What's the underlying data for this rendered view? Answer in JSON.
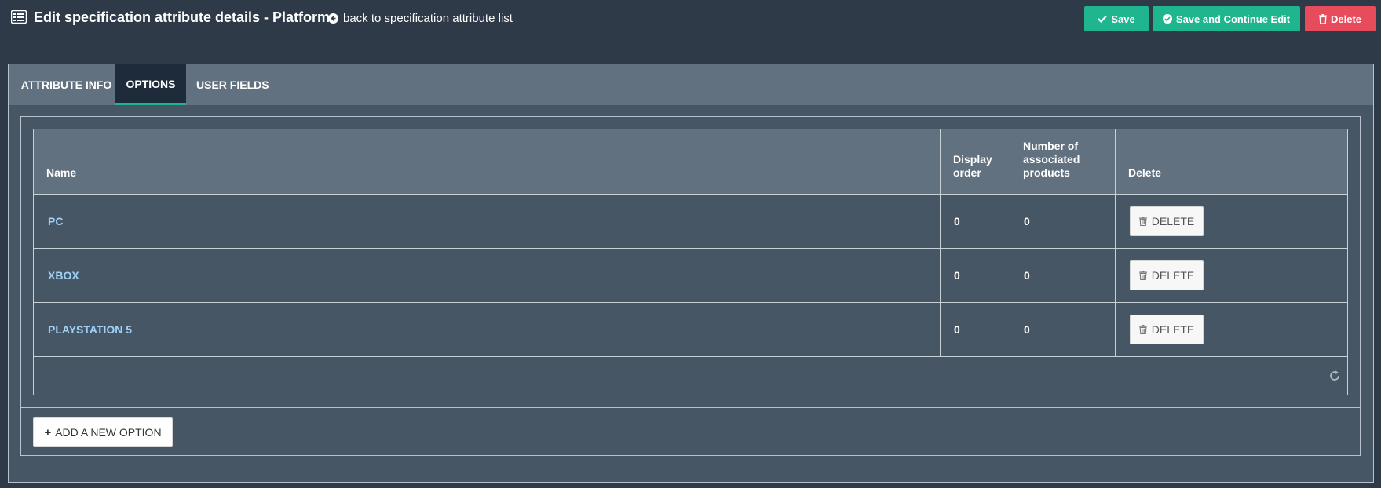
{
  "header": {
    "title": "Edit specification attribute details - Platform",
    "back_link": "back to specification attribute list",
    "save_label": "Save",
    "save_continue_label": "Save and Continue Edit",
    "delete_label": "Delete"
  },
  "tabs": [
    {
      "label": "ATTRIBUTE INFO"
    },
    {
      "label": "OPTIONS"
    },
    {
      "label": "USER FIELDS"
    }
  ],
  "active_tab": "OPTIONS",
  "grid": {
    "columns": {
      "name": "Name",
      "display_order_1": "Display",
      "display_order_2": "order",
      "products_1": "Number of",
      "products_2": "associated",
      "products_3": "products",
      "delete": "Delete"
    },
    "rows": [
      {
        "name": "PC",
        "display_order": "0",
        "products": "0",
        "delete_label": "DELETE"
      },
      {
        "name": "XBOX",
        "display_order": "0",
        "products": "0",
        "delete_label": "DELETE"
      },
      {
        "name": "PLAYSTATION 5",
        "display_order": "0",
        "products": "0",
        "delete_label": "DELETE"
      }
    ]
  },
  "add_option_label": "ADD A NEW OPTION",
  "colors": {
    "background": "#2f3a48",
    "accent": "#1fb58f",
    "danger": "#e74c5c",
    "link": "#9fd0f5"
  },
  "icons": [
    "list-icon",
    "arrow-left-circle-icon",
    "check-icon",
    "check-circle-icon",
    "trash-icon",
    "refresh-icon",
    "plus-icon"
  ]
}
